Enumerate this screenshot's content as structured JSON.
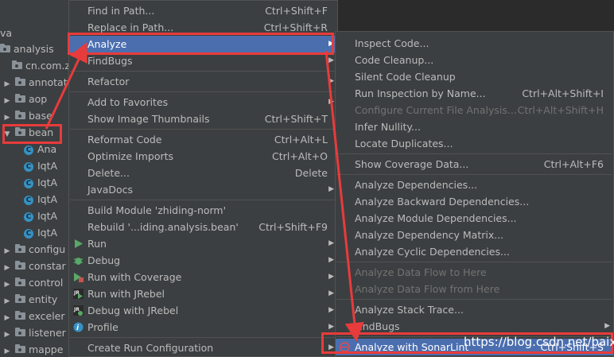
{
  "project_tree": {
    "rows": [
      {
        "arrow": "",
        "icon": "none",
        "label": "va"
      },
      {
        "arrow": "",
        "icon": "folder",
        "label": "analysis"
      },
      {
        "arrow": "",
        "icon": "folder",
        "label": "cn.com.zhi"
      },
      {
        "arrow": "▶",
        "icon": "folder",
        "label": "annotat"
      },
      {
        "arrow": "▶",
        "icon": "folder",
        "label": "aop"
      },
      {
        "arrow": "▶",
        "icon": "folder",
        "label": "base"
      },
      {
        "arrow": "▼",
        "icon": "folder",
        "label": "bean"
      },
      {
        "arrow": "",
        "icon": "class",
        "label": "Ana"
      },
      {
        "arrow": "",
        "icon": "class",
        "label": "IqtA"
      },
      {
        "arrow": "",
        "icon": "class",
        "label": "IqtA"
      },
      {
        "arrow": "",
        "icon": "class",
        "label": "IqtA"
      },
      {
        "arrow": "",
        "icon": "class",
        "label": "IqtA"
      },
      {
        "arrow": "",
        "icon": "class",
        "label": "IqtA"
      },
      {
        "arrow": "▶",
        "icon": "folder",
        "label": "configu"
      },
      {
        "arrow": "▶",
        "icon": "folder",
        "label": "constar"
      },
      {
        "arrow": "▶",
        "icon": "folder",
        "label": "control"
      },
      {
        "arrow": "▶",
        "icon": "folder",
        "label": "entity"
      },
      {
        "arrow": "▶",
        "icon": "folder",
        "label": "exceler"
      },
      {
        "arrow": "▶",
        "icon": "folder",
        "label": "listener"
      },
      {
        "arrow": "▶",
        "icon": "folder",
        "label": "mappe"
      }
    ]
  },
  "context_menu": {
    "items": [
      {
        "label": "Find in Path...",
        "shortcut": "Ctrl+Shift+F"
      },
      {
        "label": "Replace in Path...",
        "shortcut": "Ctrl+Shift+R"
      },
      {
        "label": "Analyze",
        "submenu": "▶",
        "selected": true
      },
      {
        "label": "FindBugs",
        "submenu": "▶"
      },
      {
        "separator": true
      },
      {
        "label": "Refactor",
        "submenu": "▶"
      },
      {
        "separator": true
      },
      {
        "label": "Add to Favorites",
        "submenu": "▶"
      },
      {
        "label": "Show Image Thumbnails",
        "shortcut": "Ctrl+Shift+T"
      },
      {
        "separator": true
      },
      {
        "label": "Reformat Code",
        "shortcut": "Ctrl+Alt+L"
      },
      {
        "label": "Optimize Imports",
        "shortcut": "Ctrl+Alt+O"
      },
      {
        "label": "Delete...",
        "shortcut": "Delete"
      },
      {
        "label": "JavaDocs",
        "submenu": "▶"
      },
      {
        "separator": true
      },
      {
        "label": "Build Module 'zhiding-norm'"
      },
      {
        "label": "Rebuild '...iding.analysis.bean'",
        "shortcut": "Ctrl+Shift+F9"
      },
      {
        "label": "Run",
        "submenu": "▶",
        "icon": "run-icon"
      },
      {
        "label": "Debug",
        "submenu": "▶",
        "icon": "debug-icon"
      },
      {
        "label": "Run with Coverage",
        "submenu": "▶",
        "icon": "coverage-icon"
      },
      {
        "label": "Run with JRebel",
        "submenu": "▶",
        "icon": "jrebel-run-icon"
      },
      {
        "label": "Debug with JRebel",
        "submenu": "▶",
        "icon": "jrebel-debug-icon"
      },
      {
        "label": "Profile",
        "submenu": "▶",
        "icon": "profile-icon"
      },
      {
        "separator": true
      },
      {
        "label": "Create Run Configuration",
        "submenu": "▶"
      }
    ]
  },
  "analyze_submenu": {
    "items": [
      {
        "label": "Inspect Code..."
      },
      {
        "label": "Code Cleanup..."
      },
      {
        "label": "Silent Code Cleanup"
      },
      {
        "label": "Run Inspection by Name...",
        "shortcut": "Ctrl+Alt+Shift+I"
      },
      {
        "label": "Configure Current File Analysis...",
        "shortcut": "Ctrl+Alt+Shift+H",
        "disabled": true
      },
      {
        "label": "Infer Nullity..."
      },
      {
        "label": "Locate Duplicates..."
      },
      {
        "separator": true
      },
      {
        "label": "Show Coverage Data...",
        "shortcut": "Ctrl+Alt+F6"
      },
      {
        "separator": true
      },
      {
        "label": "Analyze Dependencies..."
      },
      {
        "label": "Analyze Backward Dependencies..."
      },
      {
        "label": "Analyze Module Dependencies..."
      },
      {
        "label": "Analyze Dependency Matrix..."
      },
      {
        "label": "Analyze Cyclic Dependencies..."
      },
      {
        "separator": true
      },
      {
        "label": "Analyze Data Flow to Here",
        "disabled": true
      },
      {
        "label": "Analyze Data Flow from Here",
        "disabled": true
      },
      {
        "separator": true
      },
      {
        "label": "Analyze Stack Trace..."
      },
      {
        "label": "FindBugs",
        "submenu": "▶"
      },
      {
        "separator": true
      },
      {
        "label": "Analyze with SonarLint",
        "shortcut": "Ctrl+Shift+S",
        "selected": true,
        "icon": "sonarlint-icon"
      }
    ]
  },
  "watermark": "https://blog.csdn.net/baixf",
  "colors": {
    "accent": "#4b6eaf",
    "annotation": "#e83b3b",
    "menu_bg": "#3c3f41"
  }
}
